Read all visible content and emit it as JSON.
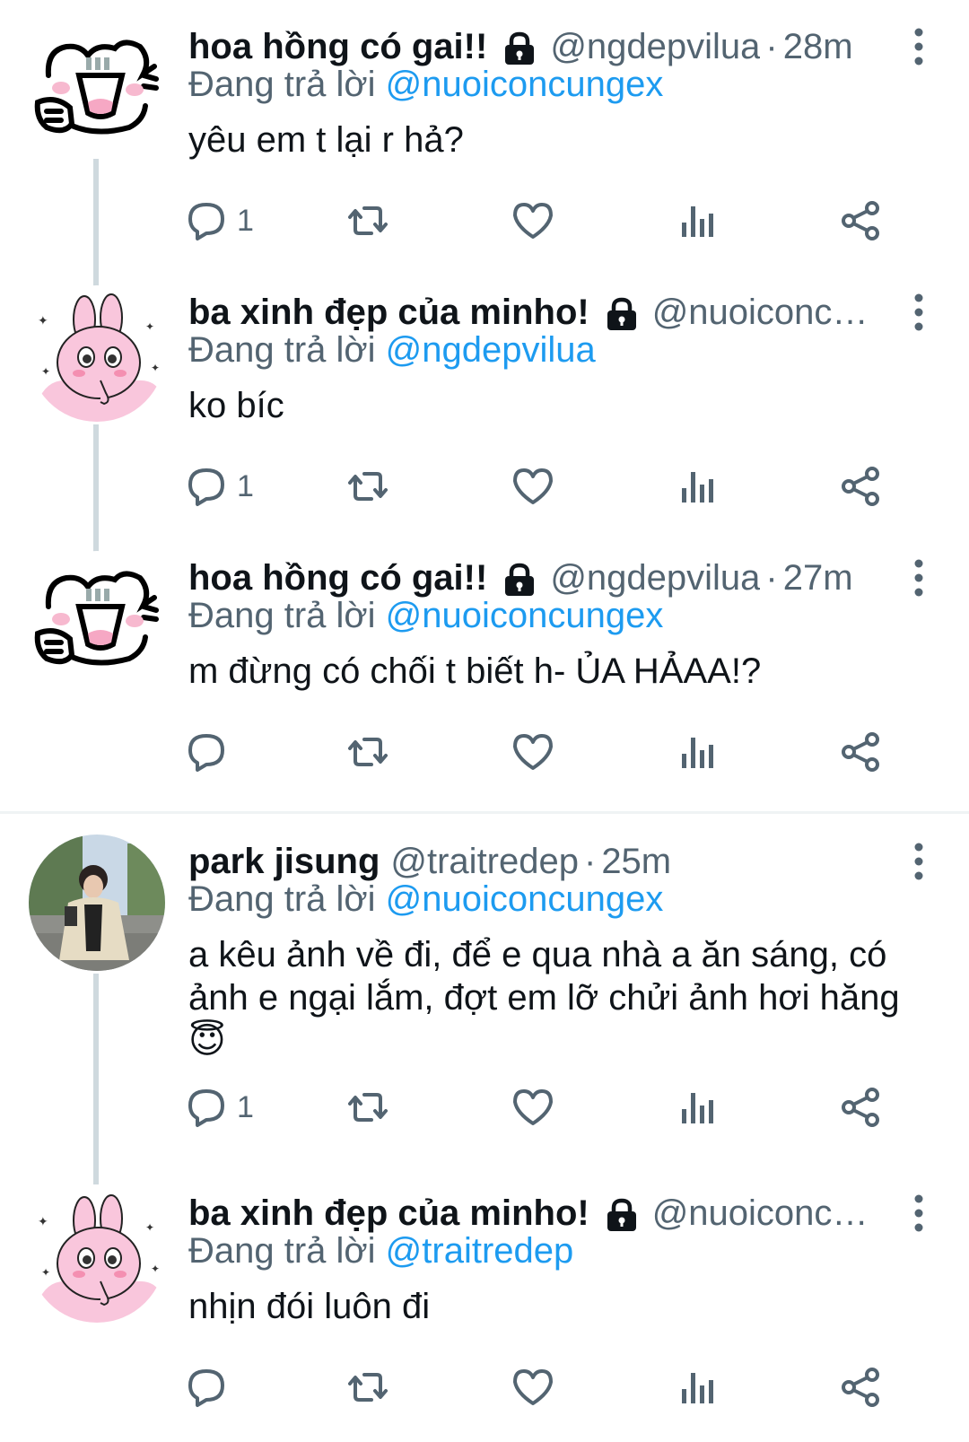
{
  "tweets": [
    {
      "name": "hoa hồng có gai!!",
      "handle": "@ngdepvilua",
      "time": "28m",
      "reply_prefix": "Đang trả lời",
      "reply_to": "@nuoiconcungex",
      "text": "yêu em t lại r hả?",
      "reply_count": "1",
      "avatar_icon": "cat-avatar-icon"
    },
    {
      "name": "ba xinh đẹp của minho!",
      "handle": "@nuoiconcu...",
      "time": "",
      "reply_prefix": "Đang trả lời",
      "reply_to": "@ngdepvilua",
      "text": "ko bíc",
      "reply_count": "1",
      "avatar_icon": "bunny-avatar-icon"
    },
    {
      "name": "hoa hồng có gai!!",
      "handle": "@ngdepvilua",
      "time": "27m",
      "reply_prefix": "Đang trả lời",
      "reply_to": "@nuoiconcungex",
      "text": "m đừng có chối t biết h- ỦA HẢAA!?",
      "reply_count": "",
      "avatar_icon": "cat-avatar-icon"
    },
    {
      "name": "park jisung",
      "handle": "@traitredep",
      "time": "25m",
      "reply_prefix": "Đang trả lời",
      "reply_to": "@nuoiconcungex",
      "text": "a kêu ảnh về đi, để e qua nhà a ăn sáng, có ảnh e ngại lắm, đợt em lỡ chửi ảnh hơi hăng 😇",
      "reply_count": "1",
      "avatar_icon": "photo-avatar-icon"
    },
    {
      "name": "ba xinh đẹp của minho!",
      "handle": "@nuoiconcu...",
      "time": "",
      "reply_prefix": "Đang trả lời",
      "reply_to": "@traitredep",
      "text": "nhịn đói luôn đi",
      "reply_count": "",
      "avatar_icon": "bunny-avatar-icon"
    }
  ],
  "icons": [
    "reply-icon",
    "retweet-icon",
    "like-icon",
    "views-icon",
    "share-icon",
    "more-icon",
    "lock-icon"
  ],
  "colors": {
    "link": "#1d9bf0",
    "muted": "#536471",
    "text": "#0f1419",
    "thread": "#cfd9de"
  }
}
